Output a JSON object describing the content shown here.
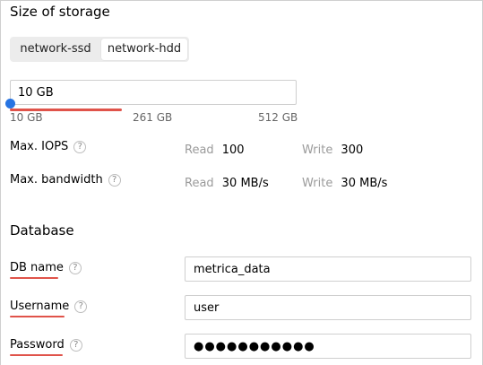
{
  "storage": {
    "title": "Size of storage",
    "disk_types": [
      "network-ssd",
      "network-hdd"
    ],
    "selected_disk_type": "network-hdd",
    "size_value": "10 GB",
    "slider_ticks": [
      "10 GB",
      "261 GB",
      "512 GB"
    ],
    "slider_level": 0
  },
  "limits": {
    "iops": {
      "label": "Max. IOPS",
      "read_label": "Read",
      "read_value": "100",
      "write_label": "Write",
      "write_value": "300"
    },
    "bandwidth": {
      "label": "Max. bandwidth",
      "read_label": "Read",
      "read_value": "30 MB/s",
      "write_label": "Write",
      "write_value": "30 MB/s"
    },
    "help_glyph": "?"
  },
  "database": {
    "title": "Database",
    "db_name": {
      "label": "DB name",
      "value": "metrica_data"
    },
    "username": {
      "label": "Username",
      "value": "user"
    },
    "password": {
      "label": "Password",
      "masked_value": "●●●●●●●●●●●"
    }
  },
  "colors": {
    "accent_blue": "#2774e2",
    "required_red": "#e0534a",
    "muted_text": "#9b9b9b"
  }
}
